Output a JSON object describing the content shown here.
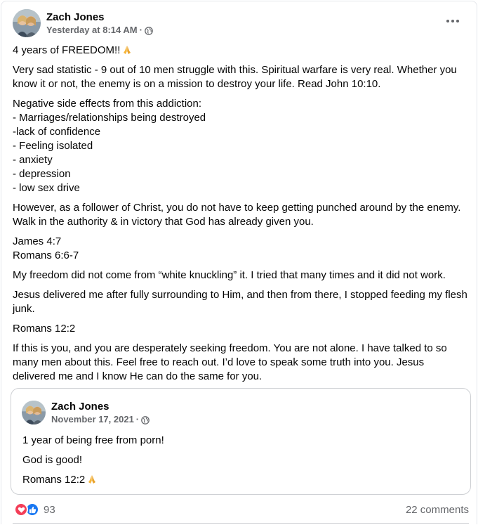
{
  "post": {
    "author": "Zach Jones",
    "timestamp": "Yesterday at 8:14 AM",
    "separator": "·",
    "audience_icon": "globe-icon",
    "menu_icon": "more-options-icon",
    "paragraphs": [
      "4 years of FREEDOM!!",
      "Very sad statistic - 9 out of 10 men struggle with this. Spiritual warfare is very real. Whether you know it or not, the enemy is on a mission to destroy your life. Read John 10:10.",
      "However, as a follower of Christ, you do not have to keep getting punched around by the enemy. Walk in the authority & in victory that God has already given you.",
      "My freedom did not come from “white knuckling” it. I tried that many times and it did not work.",
      "Jesus delivered me after fully surrounding to Him, and then from there, I stopped feeding my flesh junk.",
      "Romans 12:2",
      "If this is you, and you are desperately seeking freedom. You are not alone. I have talked to so many men about this. Feel free to reach out. I’d love to speak some truth into you. Jesus delivered me and I know He can do the same for you."
    ],
    "side_effects": {
      "heading": "Negative side effects from this addiction:",
      "items": [
        "- Marriages/relationships being destroyed",
        "-lack of confidence",
        "- Feeling isolated",
        "- anxiety",
        "- depression",
        "- low sex drive"
      ]
    },
    "verses": [
      "James 4:7",
      "Romans 6:6-7"
    ]
  },
  "shared_post": {
    "author": "Zach Jones",
    "timestamp": "November 17, 2021",
    "separator": "·",
    "lines": [
      "1 year of being free from porn!",
      "God is good!",
      "Romans 12:2"
    ]
  },
  "footer": {
    "reaction_icons": [
      "love-reaction-icon",
      "like-reaction-icon"
    ],
    "reaction_count": "93",
    "comments": "22 comments"
  },
  "colors": {
    "love": "#f33e58",
    "like": "#1877f2",
    "secondary_text": "#65676b"
  }
}
